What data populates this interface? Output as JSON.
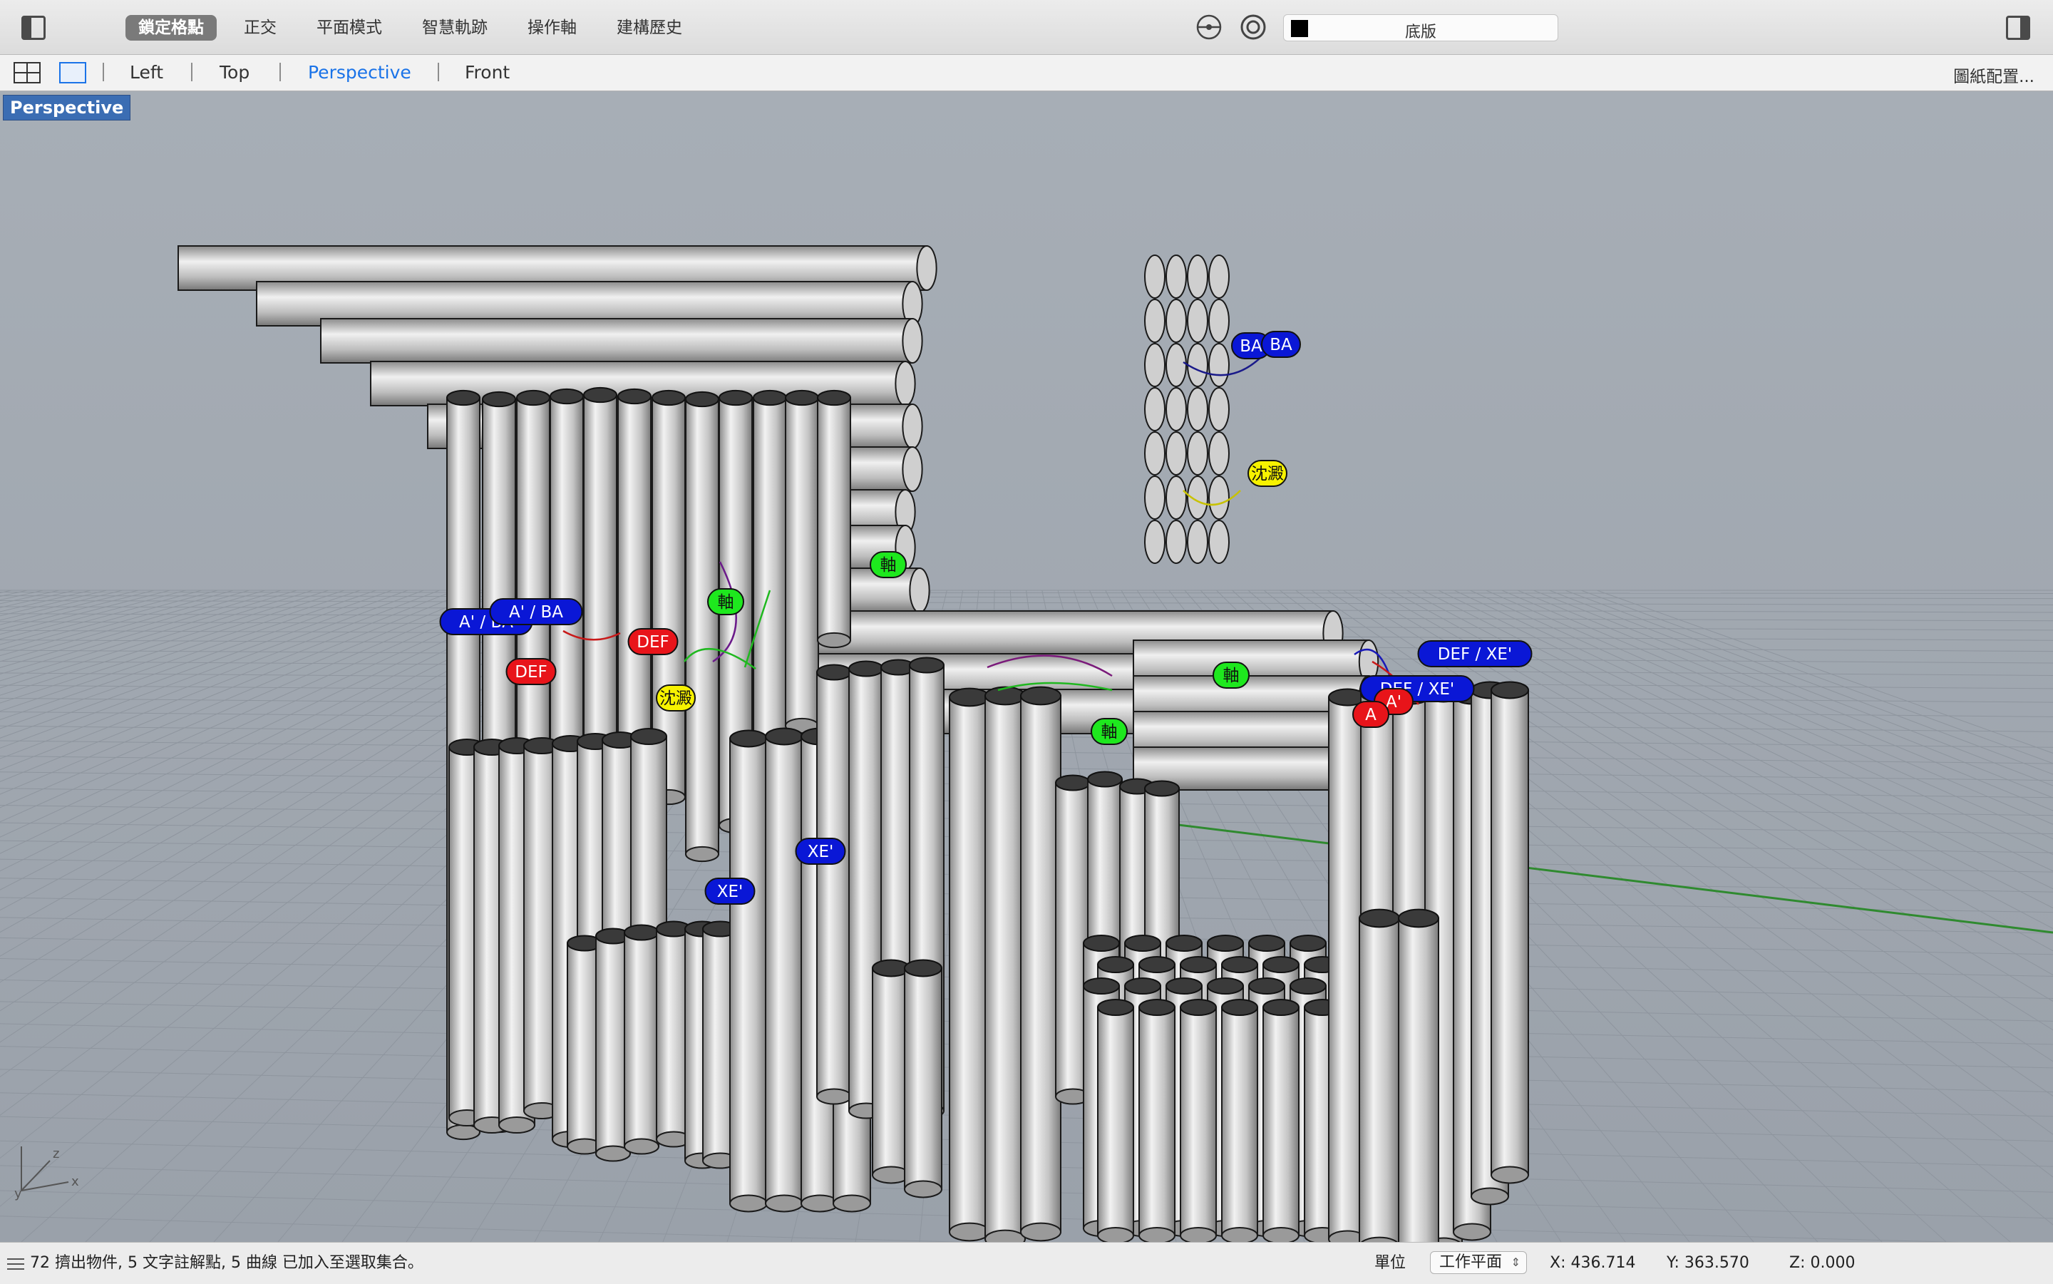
{
  "toolbar": {
    "modes": [
      "鎖定格點",
      "正交",
      "平面模式",
      "智慧軌跡",
      "操作軸",
      "建構歷史"
    ],
    "active_mode": "鎖定格點",
    "layer_name": "底版",
    "layer_color": "#000000"
  },
  "tabs": {
    "items": [
      "Left",
      "Top",
      "Perspective",
      "Front"
    ],
    "active": "Perspective",
    "layout_button": "圖紙配置..."
  },
  "viewport": {
    "title": "Perspective",
    "axis_labels": {
      "x": "x",
      "y": "y",
      "z": "z"
    },
    "tags": {
      "ba_1": "BA",
      "ba_2": "BA",
      "chen_dian_1": "沈澱",
      "chen_dian_2": "沈澱",
      "zhou_1": "軸",
      "zhou_2": "軸",
      "zhou_3": "軸",
      "zhou_4": "軸",
      "a_ba_1": "A' / BA",
      "a_ba_2": "A' / BA",
      "def_1": "DEF",
      "def_2": "DEF",
      "def_xe_1": "DEF / XE'",
      "def_xe_2": "DEF / XE'",
      "a_1": "A'",
      "a_2": "A",
      "xe_1": "XE'",
      "xe_2": "XE'"
    },
    "colors": {
      "blue": "#0a17d6",
      "red": "#e8141a",
      "yellow": "#f7f200",
      "green": "#1ee81e"
    }
  },
  "status": {
    "message": "72 擠出物件, 5 文字註解點, 5 曲線 已加入至選取集合。",
    "unit_label": "單位",
    "unit_value": "工作平面",
    "x": "X: 436.714",
    "y": "Y: 363.570",
    "z": "Z: 0.000"
  }
}
